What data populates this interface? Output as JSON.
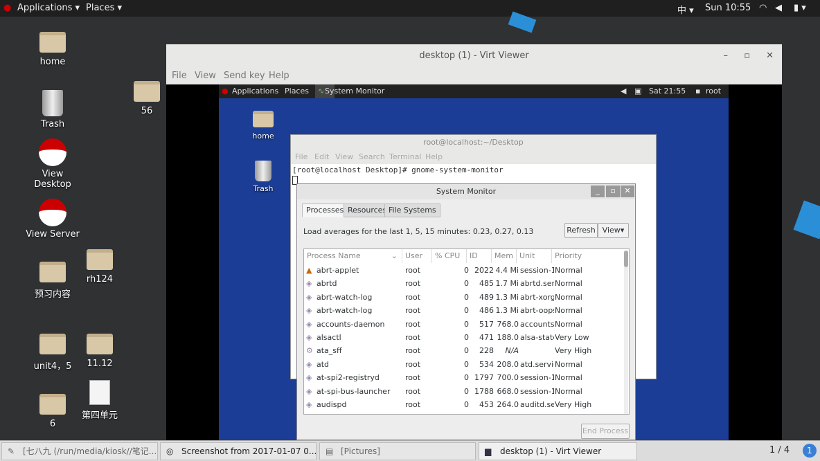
{
  "topbar": {
    "applications": "Applications",
    "places": "Places",
    "input": "中",
    "clock": "Sun 10:55"
  },
  "desktop_icons": [
    {
      "label": "home"
    },
    {
      "label": "Trash"
    },
    {
      "label": "View Desktop"
    },
    {
      "label": "View Server"
    },
    {
      "label": "预习内容"
    },
    {
      "label": "unit4，5"
    },
    {
      "label": "6"
    },
    {
      "label": "56"
    },
    {
      "label": "rh124"
    },
    {
      "label": "11.12"
    },
    {
      "label": "第四单元"
    }
  ],
  "virt_viewer": {
    "title": "desktop (1) - Virt Viewer",
    "menu": [
      "File",
      "View",
      "Send key",
      "Help"
    ]
  },
  "guest": {
    "applications": "Applications",
    "places": "Places",
    "active_app": "System Monitor",
    "clock": "Sat 21:55",
    "user": "root",
    "icons": [
      "home",
      "Trash"
    ]
  },
  "terminal": {
    "title": "root@localhost:~/Desktop",
    "menu": [
      "File",
      "Edit",
      "View",
      "Search",
      "Terminal",
      "Help"
    ],
    "line": "[root@localhost Desktop]# gnome-system-monitor"
  },
  "system_monitor": {
    "title": "System Monitor",
    "tabs": [
      "Processes",
      "Resources",
      "File Systems"
    ],
    "load": "Load averages for the last 1, 5, 15 minutes: 0.23, 0.27, 0.13",
    "refresh": "Refresh",
    "view": "View",
    "end_process": "End Process",
    "columns": [
      "Process Name",
      "User",
      "% CPU",
      "ID",
      "Mem",
      "Unit",
      "Priority"
    ],
    "rows": [
      [
        "abrt-applet",
        "root",
        "0",
        "2022",
        "4.4 Mi",
        "session-1",
        "Normal"
      ],
      [
        "abrtd",
        "root",
        "0",
        "485",
        "1.7 Mi",
        "abrtd.ser",
        "Normal"
      ],
      [
        "abrt-watch-log",
        "root",
        "0",
        "489",
        "1.3 Mi",
        "abrt-xorg",
        "Normal"
      ],
      [
        "abrt-watch-log",
        "root",
        "0",
        "486",
        "1.3 Mi",
        "abrt-oops",
        "Normal"
      ],
      [
        "accounts-daemon",
        "root",
        "0",
        "517",
        "768.0",
        "accounts-",
        "Normal"
      ],
      [
        "alsactl",
        "root",
        "0",
        "471",
        "188.0",
        "alsa-state",
        "Very Low"
      ],
      [
        "ata_sff",
        "root",
        "0",
        "228",
        "N/A",
        "",
        "Very High"
      ],
      [
        "atd",
        "root",
        "0",
        "534",
        "208.0",
        "atd.servic",
        "Normal"
      ],
      [
        "at-spi2-registryd",
        "root",
        "0",
        "1797",
        "700.0",
        "session-1",
        "Normal"
      ],
      [
        "at-spi-bus-launcher",
        "root",
        "0",
        "1788",
        "668.0",
        "session-1",
        "Normal"
      ],
      [
        "audispd",
        "root",
        "0",
        "453",
        "264.0",
        "auditd.ser",
        "Very High"
      ]
    ]
  },
  "taskbar": {
    "tasks": [
      "[七八九 (/run/media/kiosk//笔记...",
      "Screenshot from 2017-01-07 0...",
      "[Pictures]",
      "desktop (1) - Virt Viewer"
    ],
    "workspace": "1 / 4",
    "notifications": "1"
  }
}
